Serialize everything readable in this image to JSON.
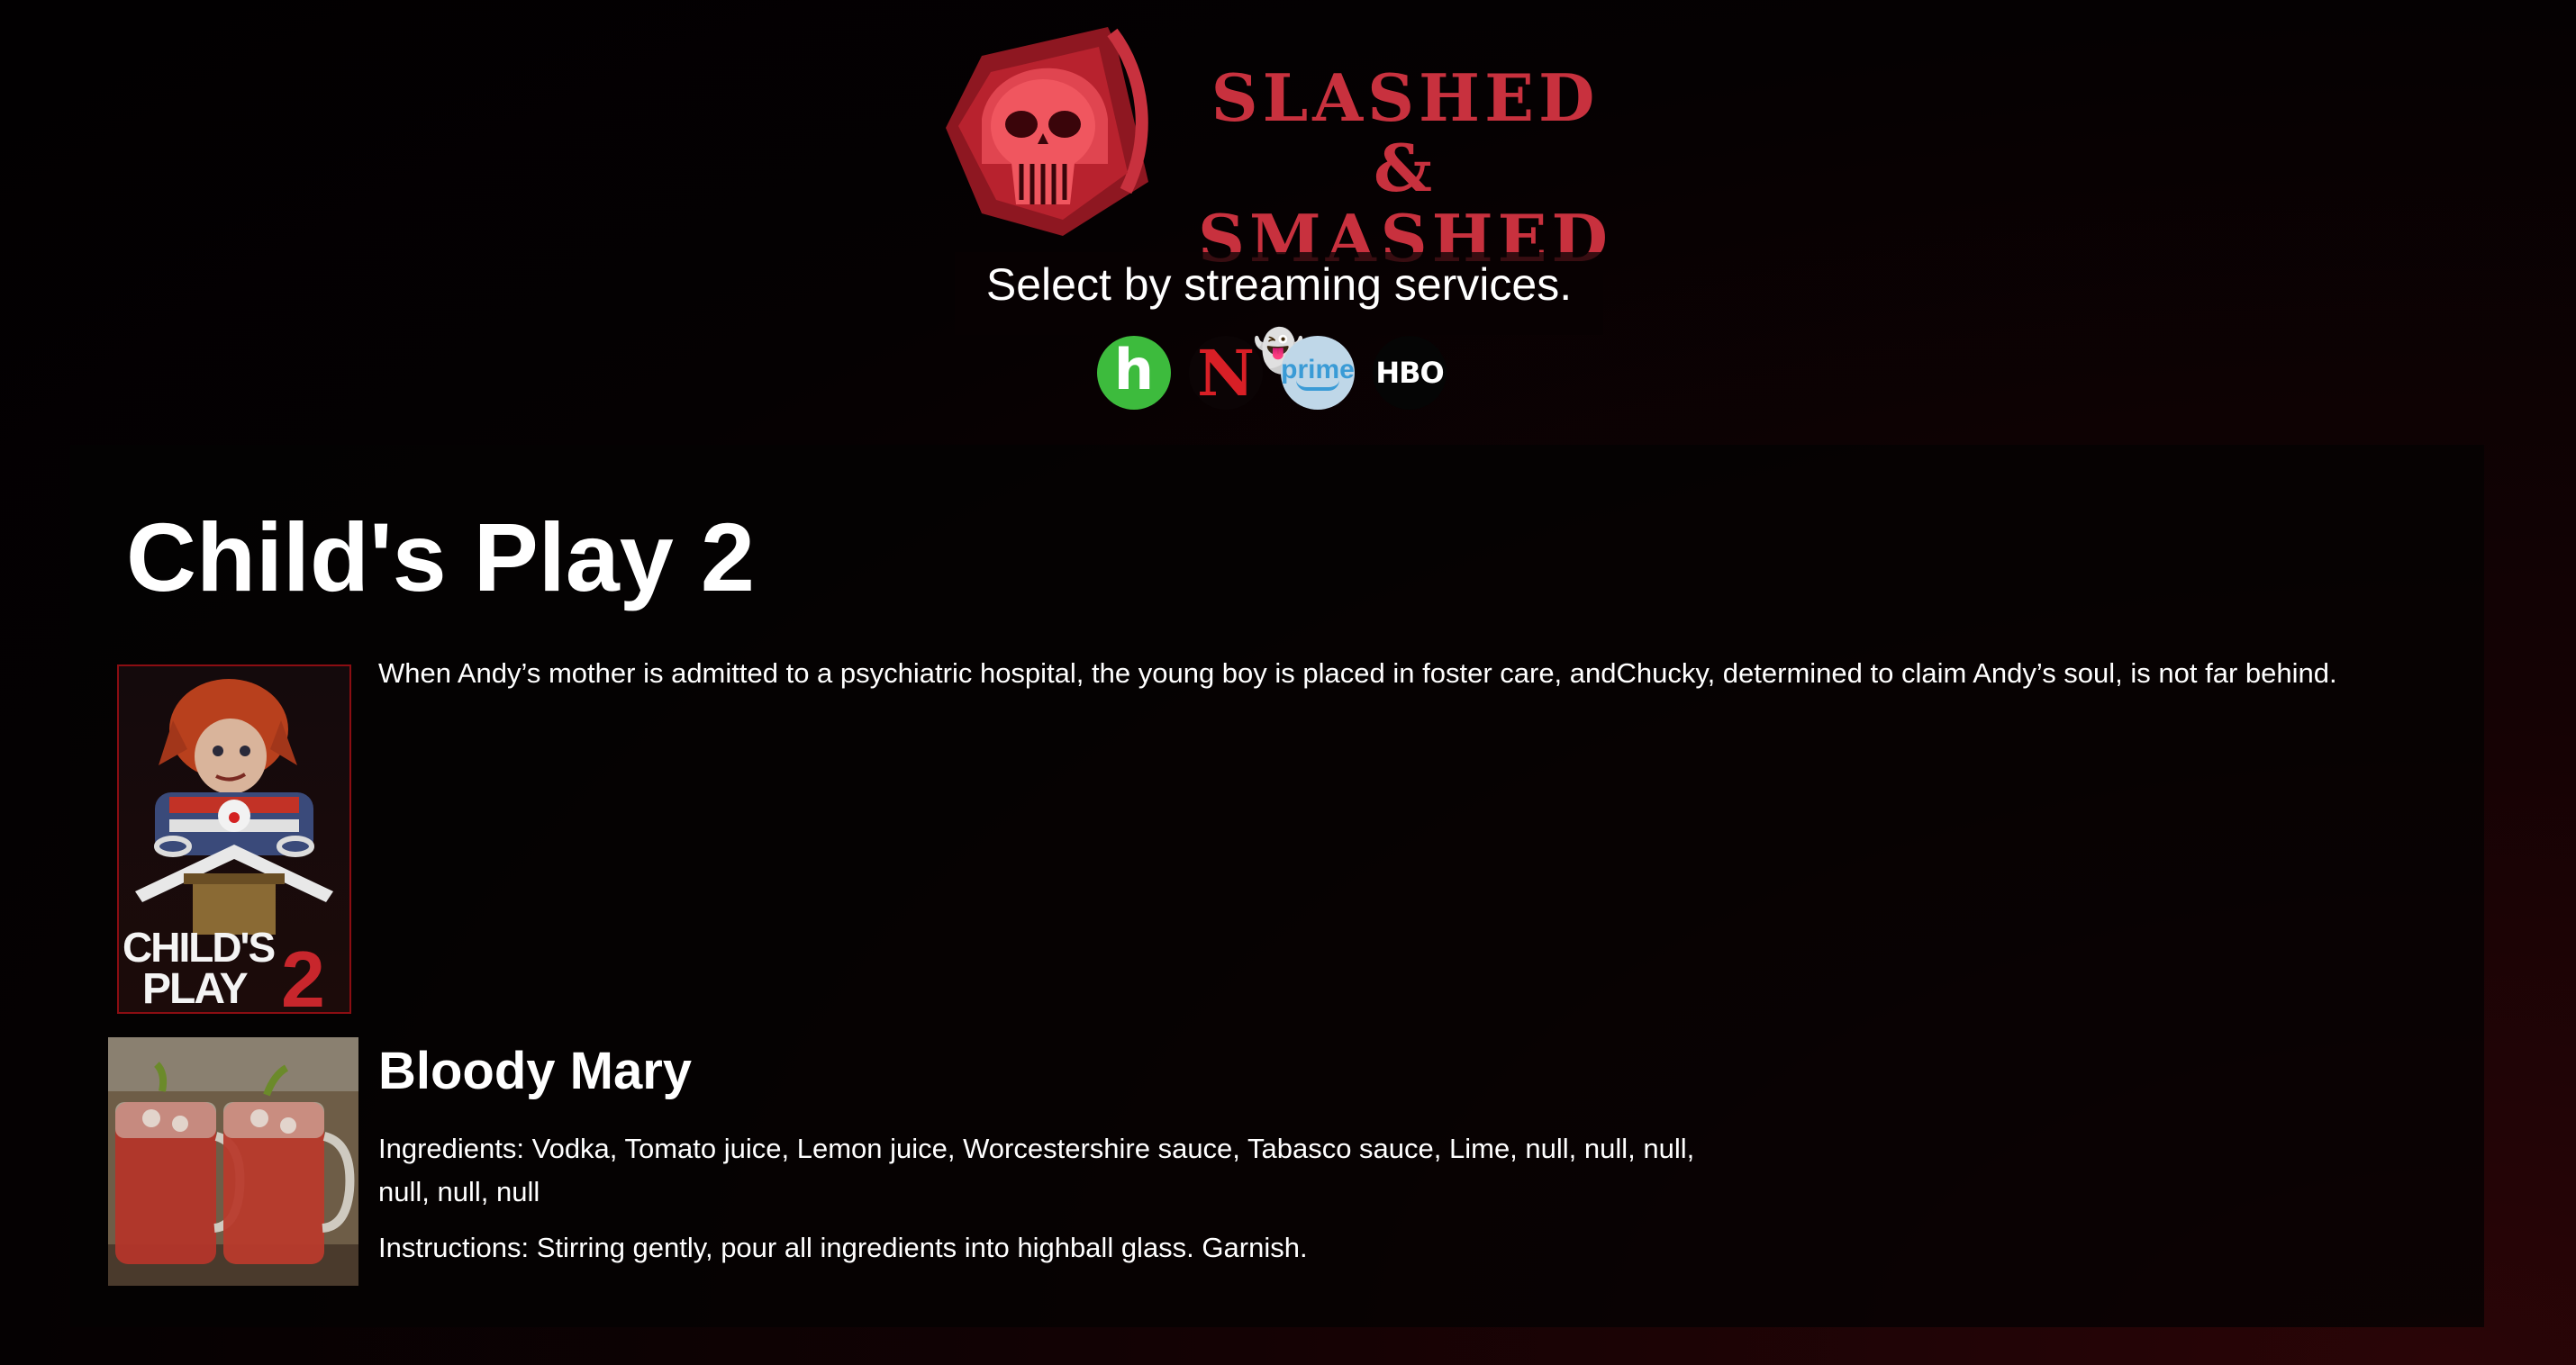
{
  "header": {
    "logo_line1": "SLASHED &",
    "logo_line2": "SMASHED",
    "tagline": "Select by streaming services.",
    "tagline_emoji": "👻",
    "services": [
      {
        "name": "hulu",
        "glyph": "h",
        "icon": "hulu-icon"
      },
      {
        "name": "netflix",
        "glyph": "N",
        "icon": "netflix-icon"
      },
      {
        "name": "prime",
        "glyph": "prime",
        "icon": "prime-video-icon"
      },
      {
        "name": "hbo",
        "glyph": "HBO",
        "icon": "hbo-icon"
      }
    ]
  },
  "movie": {
    "title": "Child's Play 2",
    "description": "When Andy’s mother is admitted to a psychiatric hospital, the young boy is placed in foster care, andChucky, determined to claim Andy’s soul, is not far behind.",
    "poster_line1": "CHILD'S",
    "poster_line2": "PLAY",
    "poster_number": "2"
  },
  "drink": {
    "name": "Bloody Mary",
    "ingredients": "Ingredients: Vodka, Tomato juice, Lemon juice, Worcestershire sauce, Tabasco sauce, Lime, null, null, null, null, null, null",
    "instructions": "Instructions: Stirring gently, pour all ingredients into highball glass. Garnish."
  },
  "colors": {
    "accent": "#c8313e",
    "hulu": "#3dbb3d",
    "netflix": "#d81f26",
    "prime": "#3a9bd6"
  }
}
